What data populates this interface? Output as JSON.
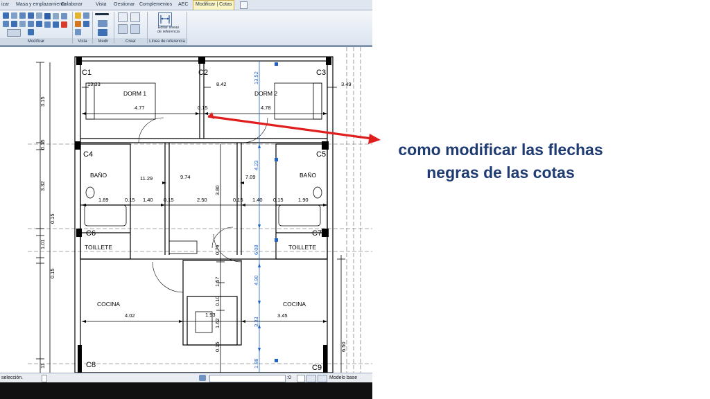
{
  "ribbon_tabs": [
    "izar",
    "Masa y emplazamiento",
    "Colaborar",
    "Vista",
    "Gestionar",
    "Complementos",
    "AEC",
    "Modificar | Cotas"
  ],
  "panels": [
    "Modificar",
    "Vista",
    "Medir",
    "Crear",
    "Línea de referencia"
  ],
  "edit_witness_button": [
    "Editar líneas",
    "de referencia"
  ],
  "status": {
    "left": "selección.",
    "zoom_value": ":0",
    "model": "Modelo base"
  },
  "plan": {
    "columns": [
      "C1",
      "C2",
      "C3",
      "C4",
      "C5",
      "C6",
      "C7",
      "C8",
      "C9"
    ],
    "rooms": [
      "DORM 1",
      "DORM 2",
      "BAÑO",
      "BAÑO",
      "TOILLETE",
      "TOILLETE",
      "COCINA",
      "COCINA"
    ],
    "horizontal_dims": [
      "13.33",
      "8.42",
      "3.49",
      "4.77",
      "0.15",
      "4.78",
      "11.29",
      "9.74",
      "7.09",
      "1.89",
      "0.15",
      "1.40",
      "0.15",
      "2.50",
      "0.15",
      "1.40",
      "0.15",
      "1.90",
      "4.02",
      "1.93",
      "3.45"
    ],
    "vertical_dims": [
      "3.15",
      "0.15",
      "3.32",
      "0.15",
      "1.01",
      "0.15",
      "3.80",
      "0.79",
      "1.57",
      "0.10",
      "1.62",
      "0.15",
      "6.50",
      "13.52",
      "4.23",
      "6.08",
      "4.90",
      "3.33",
      "1.88",
      "11"
    ]
  },
  "annotation": "como modificar las flechas negras de las cotas",
  "colors": {
    "arrow": "#e01e1e",
    "question_text": "#1f3b73",
    "dimension_blue": "#1f63c4",
    "ribbon_active": "#fbf4c4"
  }
}
